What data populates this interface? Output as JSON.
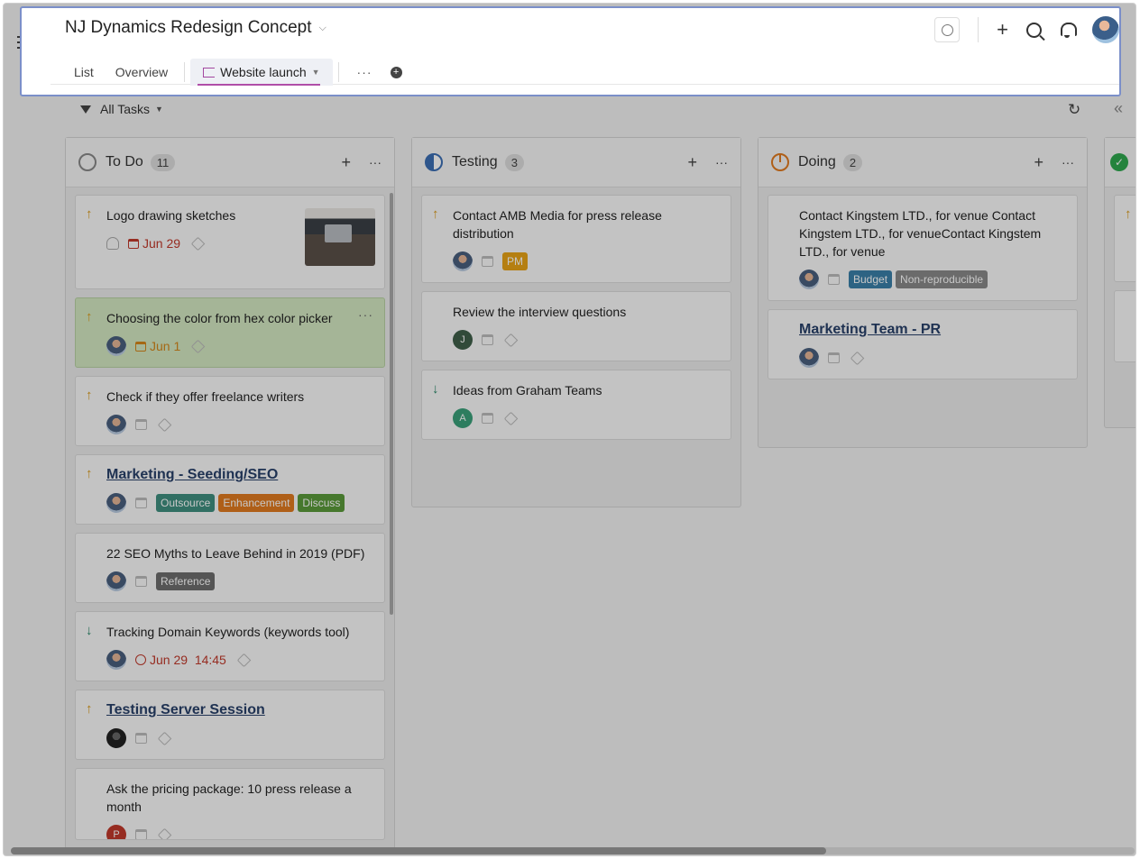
{
  "project": {
    "title": "NJ Dynamics Redesign Concept"
  },
  "tabs": [
    {
      "label": "List"
    },
    {
      "label": "Overview"
    },
    {
      "label": "Website launch"
    }
  ],
  "tab_more": "···",
  "filter": {
    "label": "All Tasks"
  },
  "columns": [
    {
      "title": "To Do",
      "count": "11",
      "cards": [
        {
          "title": "Logo drawing sketches",
          "due": "Jun 29"
        },
        {
          "title": "Choosing the color from hex color picker",
          "due": "Jun 1"
        },
        {
          "title": "Check if they offer freelance writers"
        },
        {
          "title": "Marketing - Seeding/SEO",
          "chips": [
            "Outsource",
            "Enhancement",
            "Discuss"
          ]
        },
        {
          "title": "22 SEO Myths to Leave Behind in 2019 (PDF)",
          "chips": [
            "Reference"
          ]
        },
        {
          "title": "Tracking Domain Keywords (keywords tool)",
          "due": "Jun 29  14:45"
        },
        {
          "title": "Testing Server Session"
        },
        {
          "title": "Ask the pricing package: 10 press release a month",
          "avatar": "P"
        }
      ]
    },
    {
      "title": "Testing",
      "count": "3",
      "cards": [
        {
          "title": "Contact AMB Media for press release distribution",
          "chips": [
            "PM"
          ]
        },
        {
          "title": "Review the interview questions",
          "avatar": "J"
        },
        {
          "title": "Ideas from Graham Teams",
          "avatar": "A"
        }
      ]
    },
    {
      "title": "Doing",
      "count": "2",
      "cards": [
        {
          "title": "Contact Kingstem LTD., for venue Contact Kingstem LTD., for venueContact Kingstem LTD., for venue",
          "chips": [
            "Budget",
            "Non-reproducible"
          ]
        },
        {
          "title": "Marketing Team - PR"
        }
      ]
    }
  ],
  "colors": {
    "outsource": "#3f8f7f",
    "enhancement": "#e07a1f",
    "discuss": "#5a9a3a",
    "reference": "#6e6e6e",
    "pm": "#e8a317",
    "budget": "#3a7fa8",
    "non_reproducible": "#8a8a8a",
    "accent": "#b04ea8"
  }
}
